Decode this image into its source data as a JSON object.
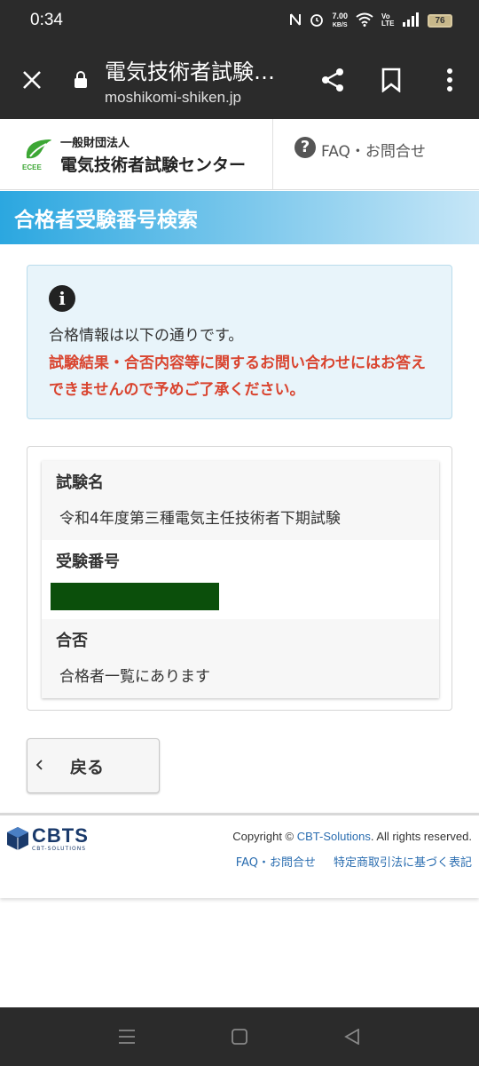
{
  "status_bar": {
    "time": "0:34",
    "speed_value": "7.00",
    "speed_unit": "KB/S",
    "volte": "Vo LTE",
    "battery": "76"
  },
  "browser": {
    "page_title": "電気技術者試験…",
    "domain": "moshikomi-shiken.jp"
  },
  "site_header": {
    "org_type": "一般財団法人",
    "org_name": "電気技術者試験センター",
    "logo_mark_text": "ECEE",
    "faq_label": "FAQ・お問合せ"
  },
  "page": {
    "title": "合格者受験番号検索"
  },
  "alert": {
    "message": "合格情報は以下の通りです。",
    "warning": "試験結果・合否内容等に関するお問い合わせにはお答えできませんので予めご了承ください。"
  },
  "result": {
    "rows": [
      {
        "label": "試験名",
        "value": "令和4年度第三種電気主任技術者下期試験"
      },
      {
        "label": "受験番号",
        "value": ""
      },
      {
        "label": "合否",
        "value": "合格者一覧にあります"
      }
    ]
  },
  "back_button": {
    "label": "戻る"
  },
  "footer": {
    "logo_text": "CBTS",
    "logo_sub": "CBT-SOLUTIONS",
    "copyright_prefix": "Copyright © ",
    "copyright_link": "CBT-Solutions",
    "copyright_suffix": ". All rights reserved.",
    "links": [
      "FAQ・お問合せ",
      "特定商取引法に基づく表記"
    ]
  },
  "colors": {
    "banner_start": "#2ba7e0",
    "warning_text": "#d9442f",
    "link": "#2a6db0",
    "redaction": "#0b4f0b"
  }
}
